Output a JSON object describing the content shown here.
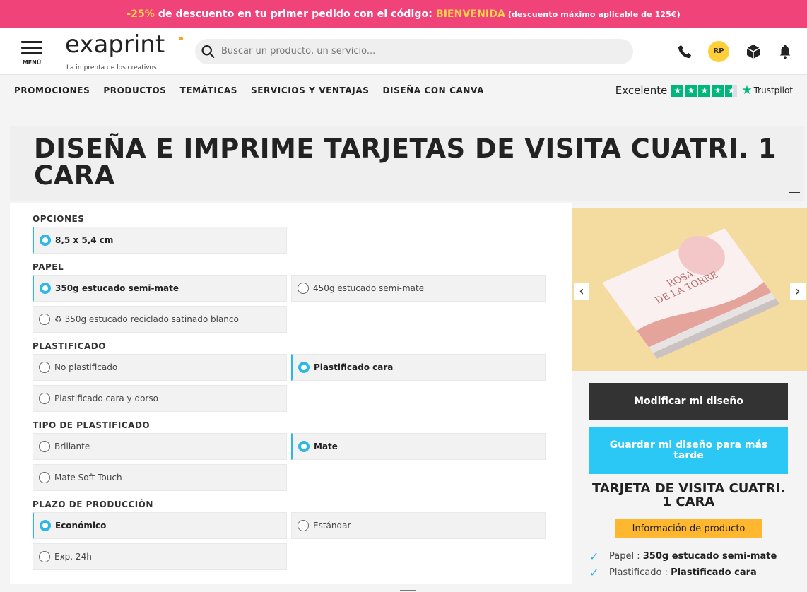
{
  "promo": {
    "discount": "-25%",
    "text_before_code": " de descuento en tu primer pedido con el código: ",
    "code": "BIENVENIDA",
    "note": "(descuento máximo aplicable de 125€)"
  },
  "header": {
    "menu_label": "MENÚ",
    "logo_text": "exaprint",
    "logo_tagline": "La imprenta de los creativos",
    "search_placeholder": "Buscar un producto, un servicio...",
    "avatar_initials": "RP"
  },
  "nav": {
    "items": [
      "PROMOCIONES",
      "PRODUCTOS",
      "TEMÁTICAS",
      "SERVICIOS Y VENTAJAS",
      "DISEÑA CON CANVA"
    ],
    "trust_label": "Excelente",
    "trust_brand": "Trustpilot",
    "trust_rating": 4.5
  },
  "page": {
    "title": "DISEÑA E IMPRIME TARJETAS DE VISITA CUATRI. 1 CARA"
  },
  "options": {
    "sections": [
      {
        "title": "OPCIONES",
        "choices": [
          {
            "label": "8,5 x 5,4 cm",
            "selected": true
          }
        ]
      },
      {
        "title": "PAPEL",
        "choices": [
          {
            "label": "350g estucado semi-mate",
            "selected": true
          },
          {
            "label": "450g estucado semi-mate",
            "selected": false
          },
          {
            "label": "♻ 350g estucado reciclado satinado blanco",
            "selected": false
          }
        ]
      },
      {
        "title": "PLASTIFICADO",
        "choices": [
          {
            "label": "No plastificado",
            "selected": false
          },
          {
            "label": "Plastificado cara",
            "selected": true
          },
          {
            "label": "Plastificado cara y dorso",
            "selected": false
          }
        ]
      },
      {
        "title": "TIPO DE PLASTIFICADO",
        "choices": [
          {
            "label": "Brillante",
            "selected": false
          },
          {
            "label": "Mate",
            "selected": true
          },
          {
            "label": "Mate Soft Touch",
            "selected": false
          }
        ]
      },
      {
        "title": "PLAZO DE PRODUCCIÓN",
        "choices": [
          {
            "label": "Económico",
            "selected": true
          },
          {
            "label": "Estándar",
            "selected": false
          },
          {
            "label": "Exp. 24h",
            "selected": false
          }
        ]
      }
    ]
  },
  "side": {
    "card_text_line1": "ROSA",
    "card_text_line2": "DE LA TORRE",
    "modify_button": "Modificar mi diseño",
    "save_button": "Guardar mi diseño para más tarde",
    "product_title": "TARJETA DE VISITA CUATRI. 1 CARA",
    "info_button": "Información de producto",
    "summary": [
      {
        "key": "Papel",
        "value": "350g estucado semi-mate"
      },
      {
        "key": "Plastificado",
        "value": "Plastificado cara"
      }
    ]
  },
  "colors": {
    "promo_bg": "#f0437a",
    "promo_highlight": "#ffd24a",
    "accent_blue": "#2bc8f5",
    "dark_button": "#333333",
    "info_button": "#ffb730",
    "trustpilot_green": "#00b67a",
    "image_bg": "#f4dca0"
  }
}
